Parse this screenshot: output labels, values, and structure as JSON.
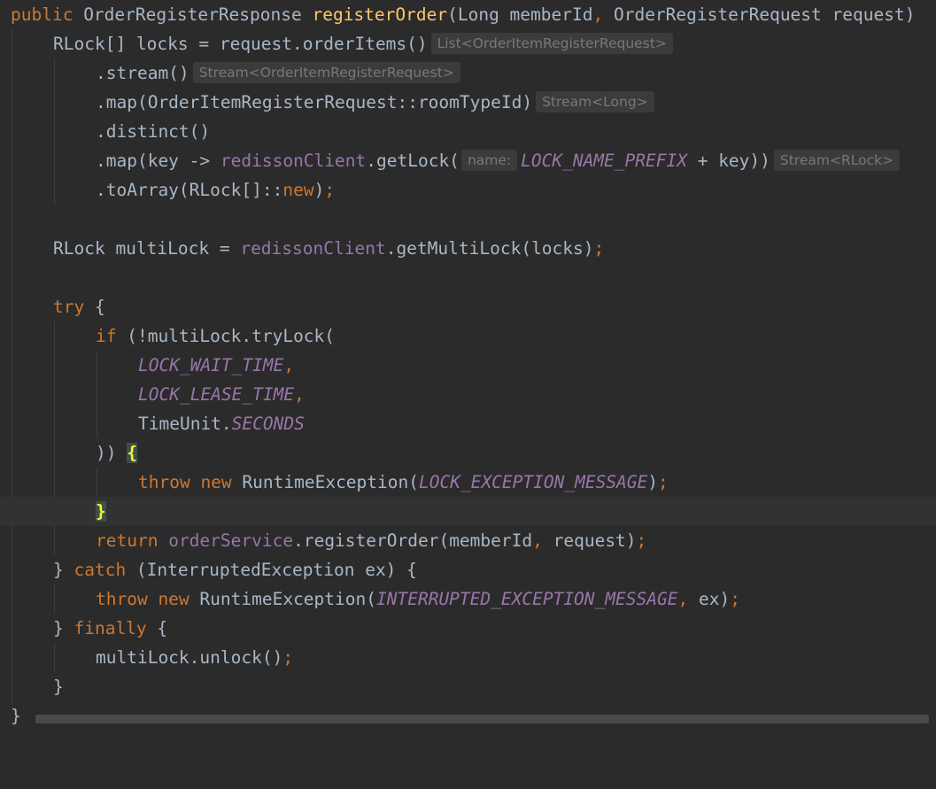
{
  "editor": {
    "theme_colors": {
      "background": "#2b2b2b",
      "keyword": "#cc7832",
      "method_declaration": "#ffc66d",
      "field": "#9876aa",
      "default_text": "#a9b7c6",
      "inlay_hint": "#787878",
      "matched_brace": "#ffef28"
    },
    "lines": {
      "l1": {
        "kw": "public",
        "t1": " OrderRegisterResponse ",
        "fn": "registerOrder",
        "t2": "(Long memberId",
        "c": ",",
        "t3": " OrderRegisterRequest request)"
      },
      "l2": {
        "t1": "RLock[] locks = request.orderItems()",
        "hint": "List<OrderItemRegisterRequest>"
      },
      "l3": {
        "t1": ".stream()",
        "hint": "Stream<OrderItemRegisterRequest>"
      },
      "l4": {
        "t1": ".map(OrderItemRegisterRequest::roomTypeId)",
        "hint": "Stream<Long>"
      },
      "l5": {
        "t1": ".distinct()"
      },
      "l6": {
        "t1": ".map(key -> ",
        "fld": "redissonClient",
        "t2": ".getLock(",
        "param": "name:",
        "cst": "LOCK_NAME_PREFIX",
        "t3": " + key))",
        "hint": "Stream<RLock>"
      },
      "l7": {
        "t1": ".toArray(RLock[]::",
        "kw": "new",
        "t2": ")",
        "semi": ";"
      },
      "l9": {
        "t1": "RLock multiLock = ",
        "fld": "redissonClient",
        "t2": ".getMultiLock(locks)",
        "semi": ";"
      },
      "l11": {
        "kw": "try",
        "t1": " {"
      },
      "l12": {
        "kw": "if",
        "t1": " (!multiLock.tryLock("
      },
      "l13": {
        "cst": "LOCK_WAIT_TIME",
        "c": ","
      },
      "l14": {
        "cst": "LOCK_LEASE_TIME",
        "c": ","
      },
      "l15": {
        "t1": "TimeUnit.",
        "cst": "SECONDS"
      },
      "l16": {
        "t1": ")) ",
        "brace": "{"
      },
      "l17": {
        "kw": "throw new",
        "t1": " RuntimeException(",
        "cst": "LOCK_EXCEPTION_MESSAGE",
        "t2": ")",
        "semi": ";"
      },
      "l18": {
        "brace": "}"
      },
      "l19": {
        "kw": "return",
        "t1": " ",
        "fld": "orderService",
        "t2": ".registerOrder(memberId",
        "c": ",",
        "t3": " request)",
        "semi": ";"
      },
      "l20": {
        "t1": "} ",
        "kw": "catch",
        "t2": " (InterruptedException ex) {"
      },
      "l21": {
        "kw": "throw new",
        "t1": " RuntimeException(",
        "cst": "INTERRUPTED_EXCEPTION_MESSAGE",
        "c": ",",
        "t2": " ex)",
        "semi": ";"
      },
      "l22": {
        "t1": "} ",
        "kw": "finally",
        "t2": " {"
      },
      "l23": {
        "t1": "multiLock.unlock()",
        "semi": ";"
      },
      "l24": {
        "t1": "}"
      },
      "l25": {
        "t1": "}"
      }
    }
  }
}
